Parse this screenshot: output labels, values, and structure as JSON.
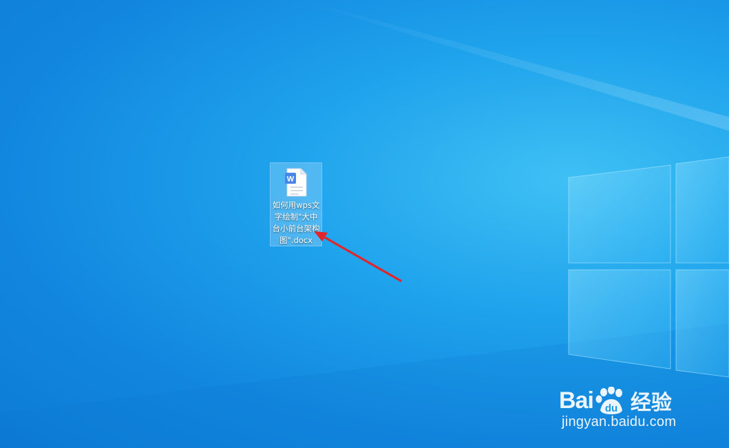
{
  "desktop": {
    "background": "Windows 10 blue",
    "accent_color": "#1287df"
  },
  "icons": [
    {
      "name": "如何用wps文字绘制\"大中台小前台架构图\".docx",
      "label_lines": [
        "如何用wps文",
        "字绘制\"大中",
        "台小前台架构",
        "图\".docx"
      ],
      "type": "wps-document-icon",
      "selected": true
    }
  ],
  "annotation": {
    "type": "arrow",
    "color": "#e0252b"
  },
  "watermark": {
    "brand_left": "Bai",
    "brand_paw": "du",
    "brand_right": "经验",
    "url": "jingyan.baidu.com"
  }
}
